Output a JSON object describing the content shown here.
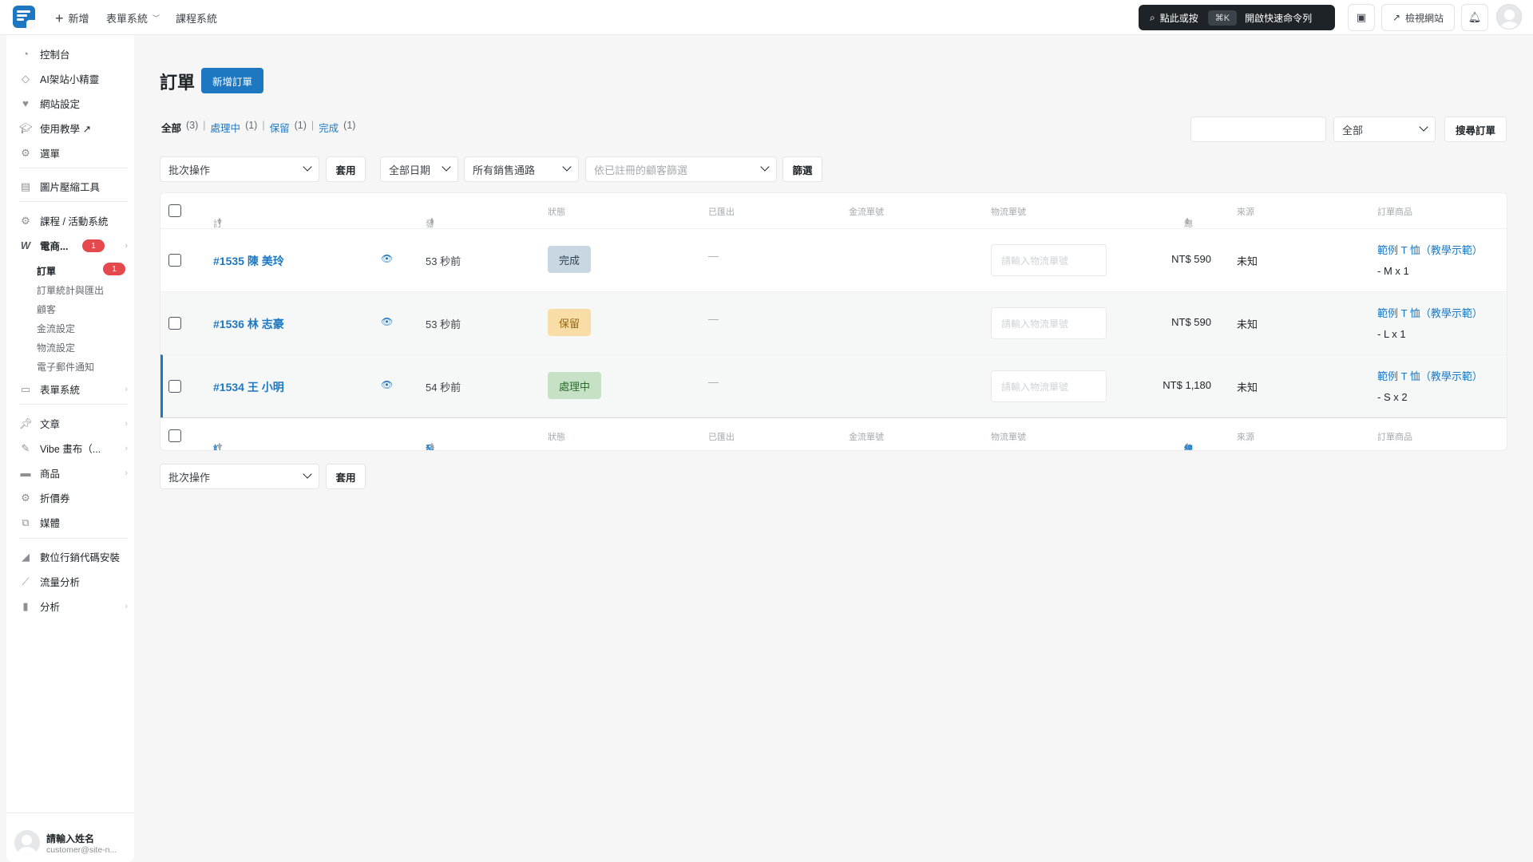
{
  "topbar": {
    "new_label": "新增",
    "forms_label": "表單系統",
    "courses_label": "課程系統",
    "cmd_prefix": "點此或按",
    "cmd_kbd": "⌘K",
    "cmd_suffix": "開啟快速命令列",
    "view_site_label": "檢視網站"
  },
  "sidebar": {
    "items": [
      {
        "label": "控制台",
        "icon": "dashboard-icon"
      },
      {
        "label": "AI架站小精靈",
        "icon": "ai-diamond-icon"
      },
      {
        "label": "網站設定",
        "icon": "heart-icon"
      },
      {
        "label": "使用教學 ↗",
        "icon": "graduation-cap-icon"
      },
      {
        "label": "選單",
        "icon": "gear-icon"
      },
      {
        "label": "圖片壓縮工具",
        "icon": "image-compress-icon"
      },
      {
        "label": "課程 / 活動系統",
        "icon": "gear-icon"
      },
      {
        "label": "電商...",
        "icon": "woo-icon",
        "badge": "1"
      },
      {
        "label": "表單系統",
        "icon": "form-icon"
      },
      {
        "label": "文章",
        "icon": "pin-icon"
      },
      {
        "label": "Vibe 畫布（...",
        "icon": "brush-icon"
      },
      {
        "label": "商品",
        "icon": "box-icon"
      },
      {
        "label": "折價券",
        "icon": "gear-icon"
      },
      {
        "label": "媒體",
        "icon": "media-icon"
      },
      {
        "label": "數位行銷代碼安裝",
        "icon": "chart-icon"
      },
      {
        "label": "流量分析",
        "icon": "trend-icon"
      },
      {
        "label": "分析",
        "icon": "bars-icon"
      }
    ],
    "sub_items": [
      {
        "label": "訂單",
        "badge": "1"
      },
      {
        "label": "訂單統計與匯出"
      },
      {
        "label": "顧客"
      },
      {
        "label": "金流設定"
      },
      {
        "label": "物流設定"
      },
      {
        "label": "電子郵件通知"
      }
    ],
    "user": {
      "name": "請輸入姓名",
      "email": "customer@site-n..."
    }
  },
  "page": {
    "title": "訂單",
    "add_button": "新增訂單",
    "filters": {
      "all": "全部",
      "all_count": "(3)",
      "processing": "處理中",
      "processing_count": "(1)",
      "on_hold": "保留",
      "on_hold_count": "(1)",
      "completed": "完成",
      "completed_count": "(1)"
    },
    "search": {
      "status_select": "全部",
      "search_button": "搜尋訂單"
    },
    "toolbar": {
      "bulk_action": "批次操作",
      "apply": "套用",
      "date_filter": "全部日期",
      "channel_filter": "所有銷售通路",
      "customer_filter_placeholder": "依已註冊的顧客篩選",
      "filter_button": "篩選"
    },
    "columns": {
      "order": "訂單",
      "date": "發佈日期",
      "status": "狀態",
      "exported": "已匯出",
      "payment_no": "金流單號",
      "tracking_no": "物流單號",
      "total": "總計",
      "source": "來源",
      "items": "訂單商品"
    },
    "tracking_placeholder": "請輸入物流單號",
    "rows": [
      {
        "order": "#1535 陳 美玲",
        "date": "53 秒前",
        "status": "完成",
        "exported": "—",
        "total": "NT$ 590",
        "source": "未知",
        "product": "範例 T 恤（教學示範）",
        "qty": "- M x 1"
      },
      {
        "order": "#1536 林 志豪",
        "date": "53 秒前",
        "status": "保留",
        "exported": "—",
        "total": "NT$ 590",
        "source": "未知",
        "product": "範例 T 恤（教學示範）",
        "qty": "- L x 1"
      },
      {
        "order": "#1534 王 小明",
        "date": "54 秒前",
        "status": "處理中",
        "exported": "—",
        "total": "NT$ 1,180",
        "source": "未知",
        "product": "範例 T 恤（教學示範）",
        "qty": "- S x 2"
      }
    ],
    "status_colors": {
      "完成": "#c8d7e1",
      "保留": "#f8dda7",
      "處理中": "#c6e1c6"
    },
    "bottom_toolbar": {
      "bulk_action": "批次操作",
      "apply": "套用"
    }
  }
}
